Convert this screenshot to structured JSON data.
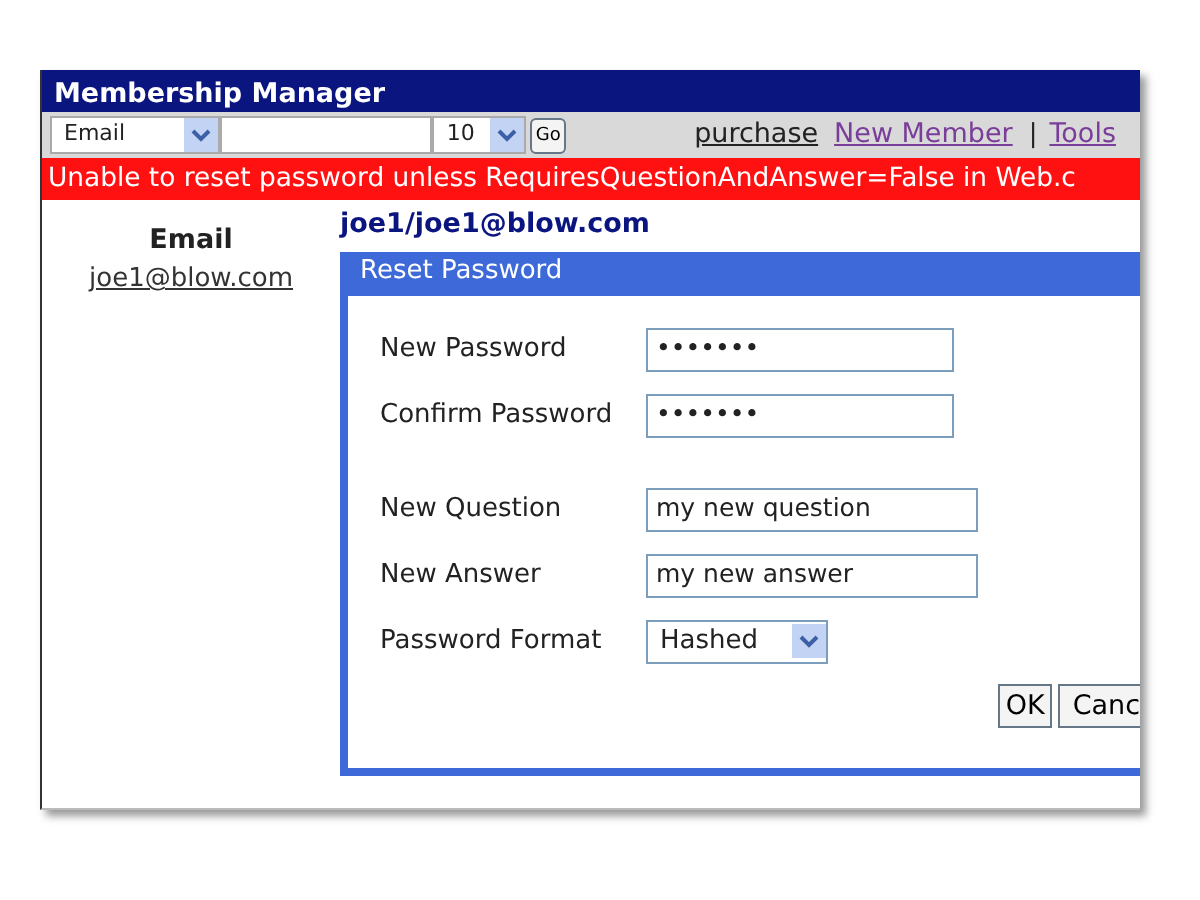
{
  "window": {
    "title": "Membership Manager"
  },
  "toolbar": {
    "filter_select": "Email",
    "page_size_select": "10",
    "go_button": "Go",
    "links": [
      {
        "kind": "link",
        "label": "purchase",
        "visited": false
      },
      {
        "kind": "link",
        "label": "New Member",
        "visited": true
      },
      {
        "kind": "separator",
        "label": "|"
      },
      {
        "kind": "link",
        "label": "Tools",
        "visited": true
      }
    ]
  },
  "error_message": "Unable to reset password unless RequiresQuestionAndAnswer=False in Web.c",
  "member": {
    "column_heading": "Email",
    "email_link": "joe1@blow.com",
    "heading": "joe1/joe1@blow.com"
  },
  "dialog": {
    "title": "Reset Password",
    "password_fields": [
      {
        "label": "New Password",
        "kind": "text",
        "value": "•••••••"
      },
      {
        "label": "Confirm Password",
        "kind": "text",
        "value": "•••••••"
      }
    ],
    "question_fields": [
      {
        "label": "New Question",
        "kind": "text",
        "value": "my new question"
      },
      {
        "label": "New Answer",
        "kind": "text",
        "value": "my new answer"
      },
      {
        "label": "Password Format",
        "kind": "select",
        "value": "Hashed"
      }
    ],
    "buttons": [
      "OK",
      "Canc"
    ]
  }
}
